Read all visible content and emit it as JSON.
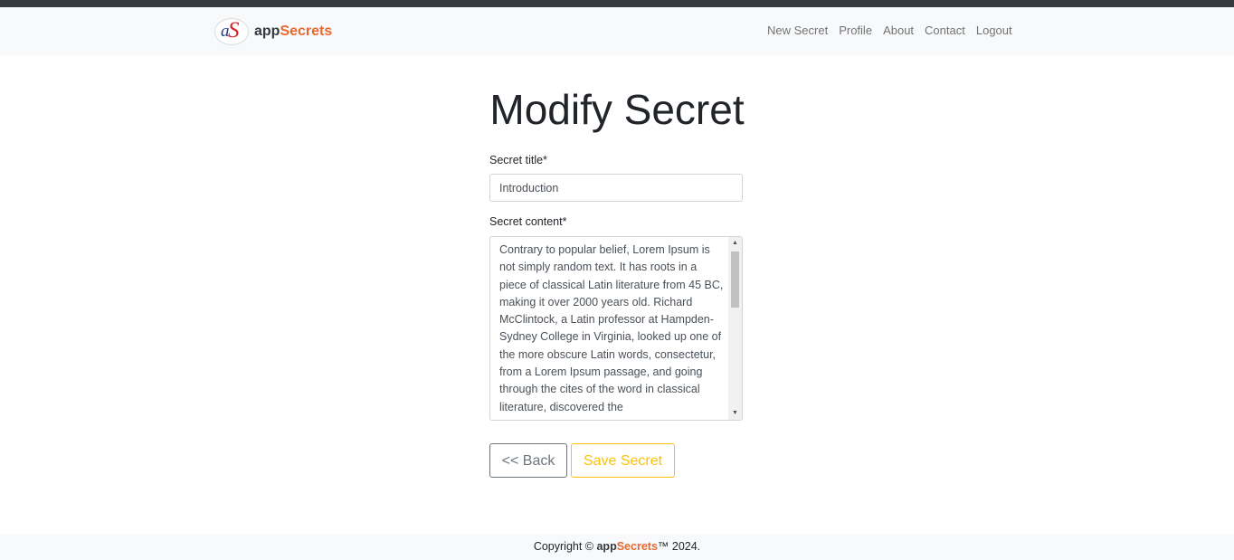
{
  "brand": {
    "logo_letters": "aS",
    "name_part1": "app",
    "name_part2": "Secrets"
  },
  "nav": {
    "items": [
      "New Secret",
      "Profile",
      "About",
      "Contact",
      "Logout"
    ]
  },
  "page": {
    "title": "Modify Secret"
  },
  "form": {
    "title_label": "Secret title*",
    "title_value": "Introduction",
    "content_label": "Secret content*",
    "content_value": "Contrary to popular belief, Lorem Ipsum is not simply random text. It has roots in a piece of classical Latin literature from 45 BC, making it over 2000 years old. Richard McClintock, a Latin professor at Hampden-Sydney College in Virginia, looked up one of the more obscure Latin words, consectetur, from a Lorem Ipsum passage, and going through the cites of the word in classical literature, discovered the",
    "scroll_up_glyph": "▲",
    "scroll_down_glyph": "▼"
  },
  "buttons": {
    "back_label": "<< Back",
    "save_label": "Save Secret"
  },
  "footer": {
    "prefix": "Copyright © ",
    "brand_part1": "app",
    "brand_part2": "Secrets",
    "suffix": "™ 2024."
  },
  "colors": {
    "brand_dark": "#343a40",
    "brand_accent": "#e8692f",
    "save_button": "#ffc107",
    "back_button": "#6c757d"
  }
}
